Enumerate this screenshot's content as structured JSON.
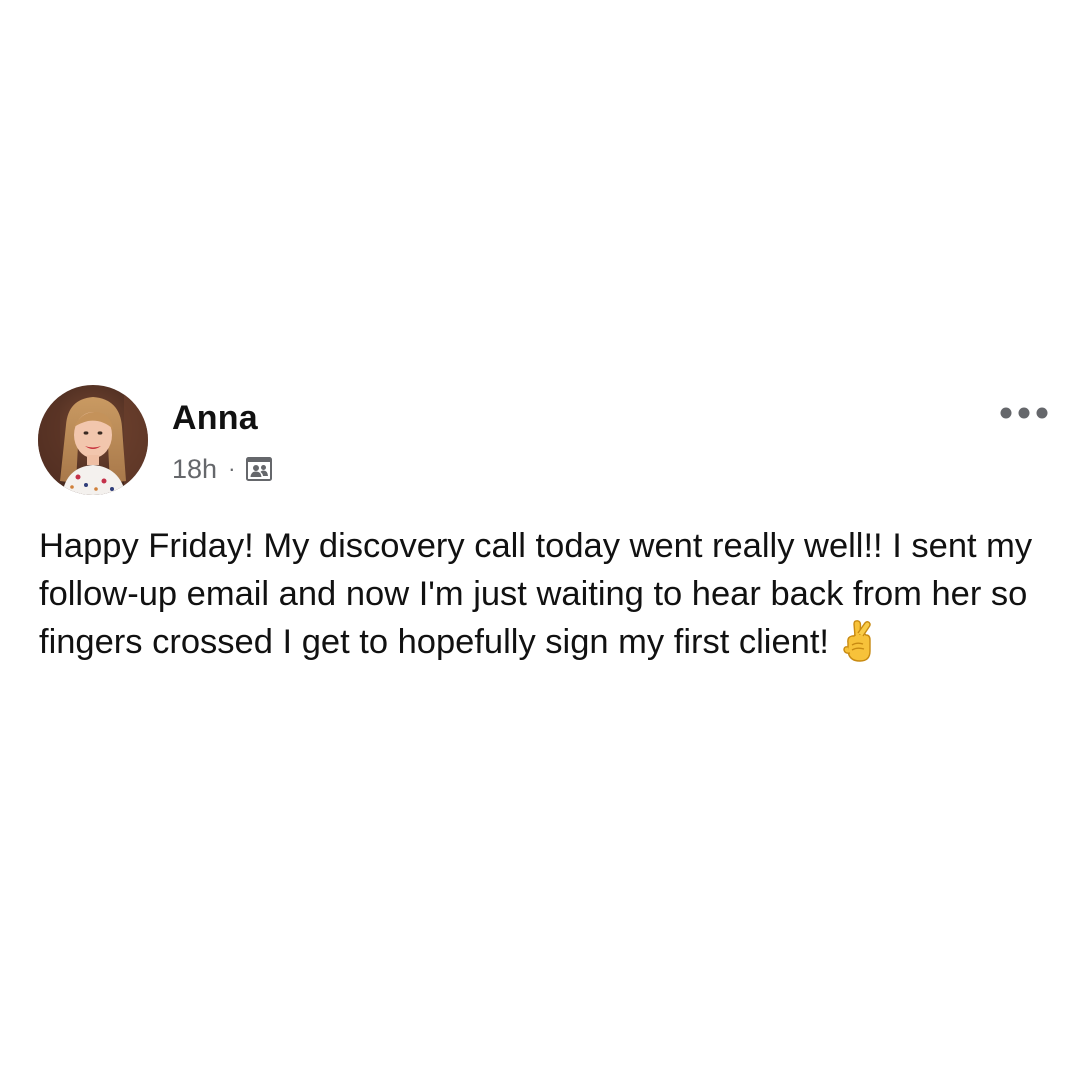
{
  "post": {
    "author": {
      "name": "Anna",
      "avatar_icon": "profile-photo"
    },
    "meta": {
      "time": "18h",
      "separator": "·",
      "privacy_icon": "group-members-icon"
    },
    "more_icon": "more-options-icon",
    "body": {
      "text": "Happy Friday! My discovery call today went really well!! I sent my follow-up email and now I'm just waiting to hear back from her so fingers crossed I get to hopefully sign my first client!",
      "emoji_icon": "crossed-fingers-emoji"
    }
  },
  "colors": {
    "background": "#ffffff",
    "text_primary": "#111111",
    "text_secondary": "#65676b",
    "icon_gray": "#65676b"
  }
}
